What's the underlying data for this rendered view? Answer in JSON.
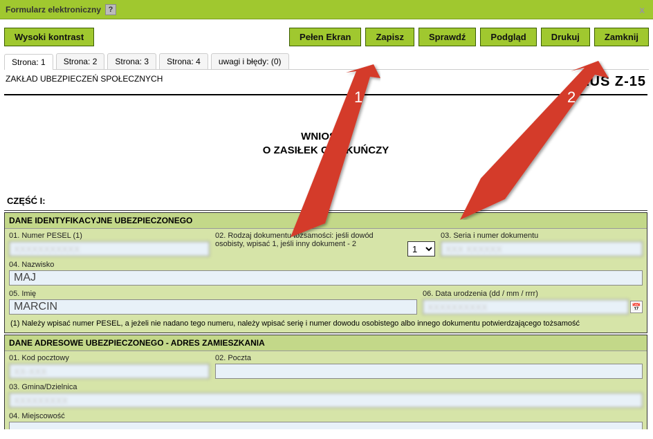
{
  "window": {
    "title": "Formularz elektroniczny",
    "close_x": "x"
  },
  "toolbar": {
    "contrast": "Wysoki kontrast",
    "fullscreen": "Pełen Ekran",
    "save": "Zapisz",
    "check": "Sprawdź",
    "preview": "Podgląd",
    "print": "Drukuj",
    "close": "Zamknij"
  },
  "tabs": {
    "p1": "Strona: 1",
    "p2": "Strona: 2",
    "p3": "Strona: 3",
    "p4": "Strona: 4",
    "errors": "uwagi i błędy: (0)"
  },
  "header": {
    "agency": "ZAKŁAD UBEZPIECZEŃ SPOŁECZNYCH",
    "form_code": "ZUS Z-15"
  },
  "title": {
    "line1": "WNIOSEK",
    "line2": "O ZASIŁEK OPIEKUŃCZY"
  },
  "part1": {
    "label": "CZĘŚĆ I:"
  },
  "sec_ident": {
    "head": "DANE IDENTYFIKACYJNE UBEZPIECZONEGO",
    "f01_label": "01. Numer PESEL (1)",
    "f01_value": "XXXXXXXXXXX",
    "f02_label": "02. Rodzaj dokumentu tożsamości: jeśli dowód osobisty, wpisać 1, jeśli inny dokument - 2",
    "f02_value": "1",
    "f03_label": "03. Seria i numer dokumentu",
    "f03_value": "XXX XXXXXX",
    "f04_label": "04. Nazwisko",
    "f04_value": "MAJ",
    "f05_label": "05. Imię",
    "f05_value": "MARCIN",
    "f06_label": "06. Data urodzenia (dd / mm / rrrr)",
    "f06_value": "XXXXXXXXXX",
    "footnote": "(1) Należy wpisać numer PESEL, a jeżeli nie nadano tego numeru, należy wpisać serię i numer dowodu osobistego albo innego dokumentu potwierdzającego tożsamość"
  },
  "sec_addr": {
    "head": "DANE ADRESOWE UBEZPIECZONEGO - ADRES ZAMIESZKANIA",
    "f01_label": "01. Kod pocztowy",
    "f01_value": "XX-XXX",
    "f02_label": "02. Poczta",
    "f02_value": "",
    "f03_label": "03. Gmina/Dzielnica",
    "f03_value": "XXXXXXXXX",
    "f04_label": "04. Miejscowość",
    "f04_value": ""
  },
  "annotations": {
    "arrow1_label": "1",
    "arrow2_label": "2"
  },
  "colors": {
    "accent": "#a0c82f",
    "section_bg": "#d6e4a8",
    "section_head": "#c3d889",
    "arrow": "#d43a2a"
  }
}
